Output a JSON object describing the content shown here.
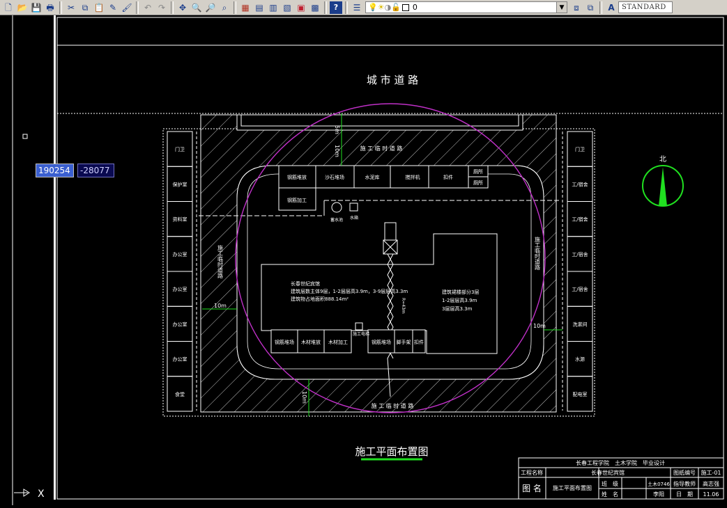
{
  "toolbar": {
    "buttons": [
      "new-icon",
      "open-icon",
      "save-icon",
      "plot-icon",
      "cut-icon",
      "copy-icon",
      "paste-icon",
      "matchprop-icon",
      "brush-icon",
      "undo-icon",
      "redo-icon",
      "pan-icon",
      "zoom-realtime-icon",
      "zoom-window-icon",
      "zoom-previous-icon",
      "properties-icon",
      "designcenter-icon",
      "toolpalette-icon",
      "sheetset-icon",
      "markup-icon",
      "calculator-icon",
      "help-icon"
    ],
    "layer_manager_icon": "layer-manager-icon",
    "current_layer": "0",
    "layer_prev_icon": "layer-previous-icon",
    "layer_state_icon": "layer-state-icon",
    "text_style_icon": "text-style-icon",
    "text_style": "STANDARD"
  },
  "coords": {
    "x": "190254",
    "y": "-28077"
  },
  "drawing": {
    "road_label": "城 市 道 路",
    "title": "施工平面布置图",
    "north": "北",
    "top_road": "施 工 临 时 道 路",
    "bottom_road": "施 工 临 时 道 路",
    "left_road": "施工临时道路",
    "right_road": "施工临时道路",
    "dim_5m": "5m",
    "dim_10m_top": "10m",
    "dim_10m_left": "10m",
    "dim_10m_right": "10m",
    "dim_10m_bottom": "10m",
    "left_rooms": [
      "门卫",
      "保护室",
      "资料室",
      "办公室",
      "办公室",
      "办公室",
      "办公室",
      "食堂"
    ],
    "right_rooms": [
      "门卫",
      "工/宿舍",
      "工/宿舍",
      "工/宿舍",
      "工/宿舍",
      "洗漱间",
      "水源",
      "配电室"
    ],
    "top_sheds": [
      "钢筋堆放",
      "沙石堆场",
      "水泥库",
      "搅拌机",
      "扣件",
      "厕所"
    ],
    "top_shed2": "厕所",
    "rebar_process": "钢筋加工",
    "water_tank": "水箱",
    "water_pool": "蓄水池",
    "bottom_sheds": [
      "钢筋堆场",
      "木材堆放",
      "木材加工"
    ],
    "bottom_sheds2": [
      "钢筋堆场",
      "脚手架",
      "扣件"
    ],
    "hoist": "施工电梯",
    "building_text": [
      "长春世纪宾馆",
      "建筑层数主体9层，1-2层层高3.9m，3-9层层高3.3m",
      "建筑物占地面积888.14m²"
    ],
    "annex_text": [
      "建筑裙楼部分3层",
      "1-2层层高3.9m",
      "3层层高3.3m"
    ],
    "crane_radius": "R=43m",
    "titleblock": {
      "school": "长春工程学院　土木学院　毕业设计",
      "project_label": "工程名称",
      "project": "长春世纪宾馆",
      "drawing_no_label": "图纸编号",
      "drawing_no": "施工-01",
      "figure_label": "图 名",
      "figure": "施工平面布置图",
      "class_label": "班　级",
      "class": "土木0746",
      "advisor_label": "指导教师",
      "advisor": "高志强",
      "name_label": "姓　名",
      "name": "李阳",
      "date_label": "日　期",
      "date": "11.06"
    }
  }
}
